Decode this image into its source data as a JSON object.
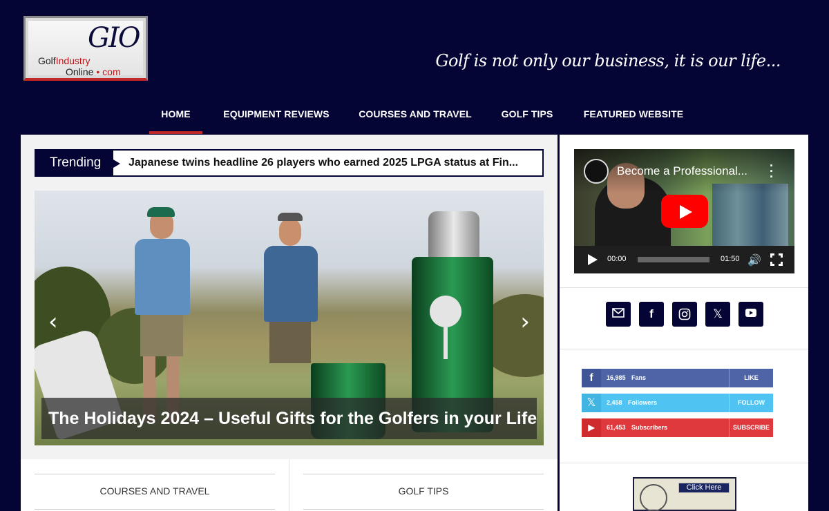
{
  "header": {
    "logo": {
      "line1_black": "Golf",
      "line1_red": "Industry",
      "line2_black": "Online",
      "line2_dot": "•",
      "line2_red": "com",
      "emblem": "GIO"
    },
    "tagline": "Golf is not only our business, it is our life..."
  },
  "nav": {
    "items": [
      {
        "label": "HOME",
        "active": true
      },
      {
        "label": "EQUIPMENT REVIEWS"
      },
      {
        "label": "COURSES AND TRAVEL"
      },
      {
        "label": "GOLF TIPS"
      },
      {
        "label": "FEATURED WEBSITE"
      }
    ]
  },
  "trending": {
    "label": "Trending",
    "headline": "Japanese twins headline 26 players who earned 2025 LPGA status at Fin..."
  },
  "slider": {
    "caption": "The Holidays 2024 – Useful Gifts for the Golfers in your Life",
    "prev_icon": "chevron-left-icon",
    "next_icon": "chevron-right-icon",
    "prev_glyph": "‹",
    "next_glyph": "›"
  },
  "categories": [
    {
      "label": "COURSES AND TRAVEL"
    },
    {
      "label": "GOLF TIPS"
    }
  ],
  "video": {
    "title": "Become a Professional...",
    "current_time": "00:00",
    "duration": "01:50",
    "progress": 0
  },
  "social_icons": [
    {
      "name": "email-icon"
    },
    {
      "name": "facebook-icon",
      "glyph": "f"
    },
    {
      "name": "instagram-icon"
    },
    {
      "name": "x-icon",
      "glyph": "𝕏"
    },
    {
      "name": "youtube-icon"
    }
  ],
  "counters": [
    {
      "icon": "facebook-icon",
      "glyph": "f",
      "count": "16,985",
      "label": "Fans",
      "action": "LIKE",
      "color": "#4e64a7"
    },
    {
      "icon": "x-icon",
      "glyph": "𝕏",
      "count": "2,458",
      "label": "Followers",
      "action": "FOLLOW",
      "color": "#4fc4f3"
    },
    {
      "icon": "youtube-icon",
      "glyph": "▶",
      "count": "61,453",
      "label": "Subscribers",
      "action": "SUBSCRIBE",
      "color": "#e0393d"
    }
  ],
  "banner": {
    "button": "Click Here"
  },
  "colors": {
    "navy": "#050535",
    "accent_red": "#c0282a"
  }
}
